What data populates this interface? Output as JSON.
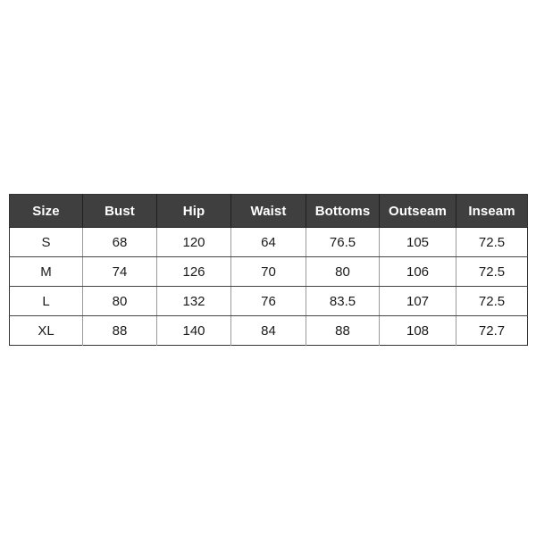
{
  "page": {
    "background_color": "#ffffff"
  },
  "chart_data": {
    "type": "table",
    "title": "",
    "header_background_color": "#403f3f",
    "header_text_color": "#ffffff",
    "cell_text_color": "#1a1a1a",
    "columns": [
      "Size",
      "Bust",
      "Hip",
      "Waist",
      "Bottoms",
      "Outseam",
      "Inseam"
    ],
    "rows": [
      [
        "S",
        "68",
        "120",
        "64",
        "76.5",
        "105",
        "72.5"
      ],
      [
        "M",
        "74",
        "126",
        "70",
        "80",
        "106",
        "72.5"
      ],
      [
        "L",
        "80",
        "132",
        "76",
        "83.5",
        "107",
        "72.5"
      ],
      [
        "XL",
        "88",
        "140",
        "84",
        "88",
        "108",
        "72.7"
      ]
    ]
  },
  "table": {
    "headers": {
      "size": "Size",
      "bust": "Bust",
      "hip": "Hip",
      "waist": "Waist",
      "bottoms": "Bottoms",
      "outseam": "Outseam",
      "inseam": "Inseam"
    },
    "rows": [
      {
        "size": "S",
        "bust": "68",
        "hip": "120",
        "waist": "64",
        "bottoms": "76.5",
        "outseam": "105",
        "inseam": "72.5"
      },
      {
        "size": "M",
        "bust": "74",
        "hip": "126",
        "waist": "70",
        "bottoms": "80",
        "outseam": "106",
        "inseam": "72.5"
      },
      {
        "size": "L",
        "bust": "80",
        "hip": "132",
        "waist": "76",
        "bottoms": "83.5",
        "outseam": "107",
        "inseam": "72.5"
      },
      {
        "size": "XL",
        "bust": "88",
        "hip": "140",
        "waist": "84",
        "bottoms": "88",
        "outseam": "108",
        "inseam": "72.7"
      }
    ]
  }
}
